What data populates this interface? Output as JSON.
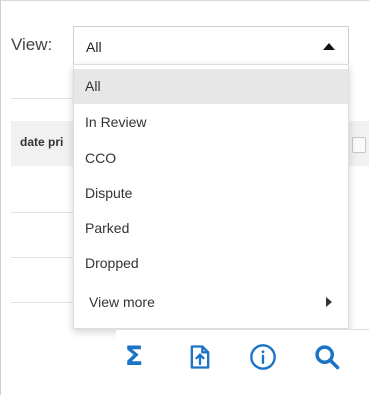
{
  "view": {
    "label": "View:",
    "selected_value": "All"
  },
  "table": {
    "column_header": "date pri"
  },
  "dropdown": {
    "items": [
      {
        "label": "All",
        "selected": true
      },
      {
        "label": "In Review",
        "selected": false
      },
      {
        "label": "CCO",
        "selected": false
      },
      {
        "label": "Dispute",
        "selected": false
      },
      {
        "label": "Parked",
        "selected": false
      },
      {
        "label": "Dropped",
        "selected": false
      }
    ],
    "view_more_label": "View more"
  },
  "toolbar": {
    "icons": [
      "sigma-icon",
      "export-file-icon",
      "info-icon",
      "search-icon"
    ]
  },
  "colors": {
    "accent": "#1a73c7",
    "selected_row": "#e7e7e7"
  }
}
